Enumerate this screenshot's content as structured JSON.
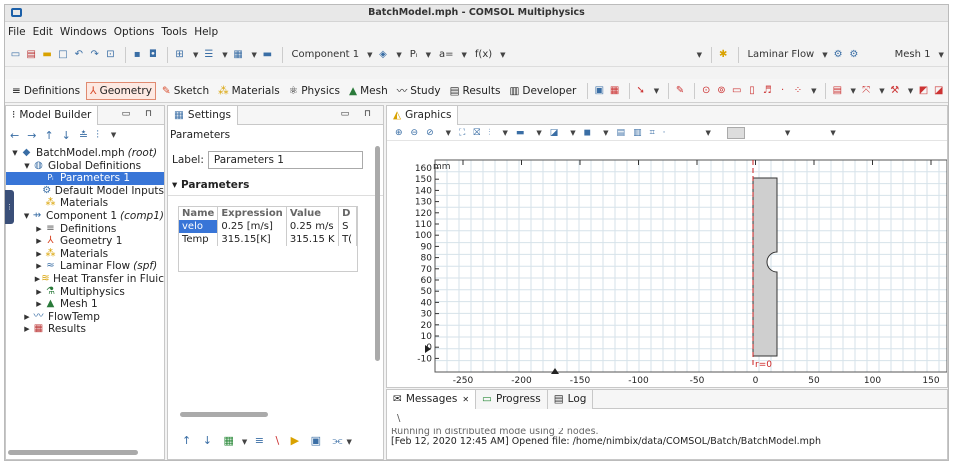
{
  "window": {
    "title": "BatchModel.mph - COMSOL Multiphysics"
  },
  "menu": [
    "File",
    "Edit",
    "Windows",
    "Options",
    "Tools",
    "Help"
  ],
  "toolbar": {
    "component_label": "Component 1",
    "physics_label": "Laminar Flow",
    "mesh_label": "Mesh 1",
    "pi_label": "Pᵢ",
    "a_label": "a=",
    "fx_label": "f(x)"
  },
  "ribbon": {
    "tabs": [
      "Definitions",
      "Geometry",
      "Sketch",
      "Materials",
      "Physics",
      "Mesh",
      "Study",
      "Results",
      "Developer"
    ],
    "active": "Geometry"
  },
  "model_builder": {
    "title": "Model Builder",
    "tree": [
      {
        "label": "BatchModel.mph",
        "suffix": "(root)",
        "level": 0,
        "expanded": true,
        "icon": "model-icon"
      },
      {
        "label": "Global Definitions",
        "level": 1,
        "expanded": true,
        "icon": "globe-icon"
      },
      {
        "label": "Parameters 1",
        "level": 2,
        "selected": true,
        "icon": "parameter-icon"
      },
      {
        "label": "Default Model Inputs",
        "level": 2,
        "icon": "inputs-icon"
      },
      {
        "label": "Materials",
        "level": 2,
        "icon": "materials-icon"
      },
      {
        "label": "Component 1",
        "suffix": "(comp1)",
        "level": 1,
        "expanded": true,
        "icon": "component-icon"
      },
      {
        "label": "Definitions",
        "level": 2,
        "collapsed": true,
        "icon": "definitions-icon"
      },
      {
        "label": "Geometry 1",
        "level": 2,
        "collapsed": true,
        "icon": "geometry-icon"
      },
      {
        "label": "Materials",
        "level": 2,
        "collapsed": true,
        "icon": "materials-icon"
      },
      {
        "label": "Laminar Flow",
        "suffix": "(spf)",
        "level": 2,
        "collapsed": true,
        "icon": "flow-icon"
      },
      {
        "label": "Heat Transfer in Fluic",
        "level": 2,
        "collapsed": true,
        "icon": "heat-icon"
      },
      {
        "label": "Multiphysics",
        "level": 2,
        "collapsed": true,
        "icon": "multiphysics-icon"
      },
      {
        "label": "Mesh 1",
        "level": 2,
        "collapsed": true,
        "icon": "mesh-icon"
      },
      {
        "label": "FlowTemp",
        "level": 1,
        "collapsed": true,
        "icon": "study-icon"
      },
      {
        "label": "Results",
        "level": 1,
        "collapsed": true,
        "icon": "results-icon"
      }
    ]
  },
  "settings": {
    "title": "Settings",
    "subtitle": "Parameters",
    "label_caption": "Label:",
    "label_value": "Parameters 1",
    "section": "Parameters",
    "columns": [
      "Name",
      "Expression",
      "Value",
      "D"
    ],
    "rows": [
      [
        "velo",
        "0.25 [m/s]",
        "0.25 m/s",
        "S"
      ],
      [
        "Temp",
        "315.15[K]",
        "315.15 K",
        "T("
      ]
    ]
  },
  "graphics": {
    "title": "Graphics",
    "unit": "mm",
    "yticks": [
      "160",
      "150",
      "140",
      "130",
      "120",
      "110",
      "100",
      "90",
      "80",
      "70",
      "60",
      "50",
      "40",
      "30",
      "20",
      "10",
      "0",
      "-10"
    ],
    "xticks": [
      "-250",
      "-200",
      "-150",
      "-100",
      "-50",
      "0",
      "50",
      "100",
      "150"
    ],
    "axis_label": "r=0"
  },
  "messages": {
    "tabs": [
      "Messages",
      "Progress",
      "Log"
    ],
    "lines": [
      "Running in distributed mode using 2 nodes.",
      "[Feb 12, 2020 12:45 AM] Opened file: /home/nimbix/data/COMSOL/Batch/BatchModel.mph"
    ]
  },
  "colors": {
    "selection": "#3875d7",
    "accent": "#e08a70",
    "axis": "#cc2222"
  }
}
